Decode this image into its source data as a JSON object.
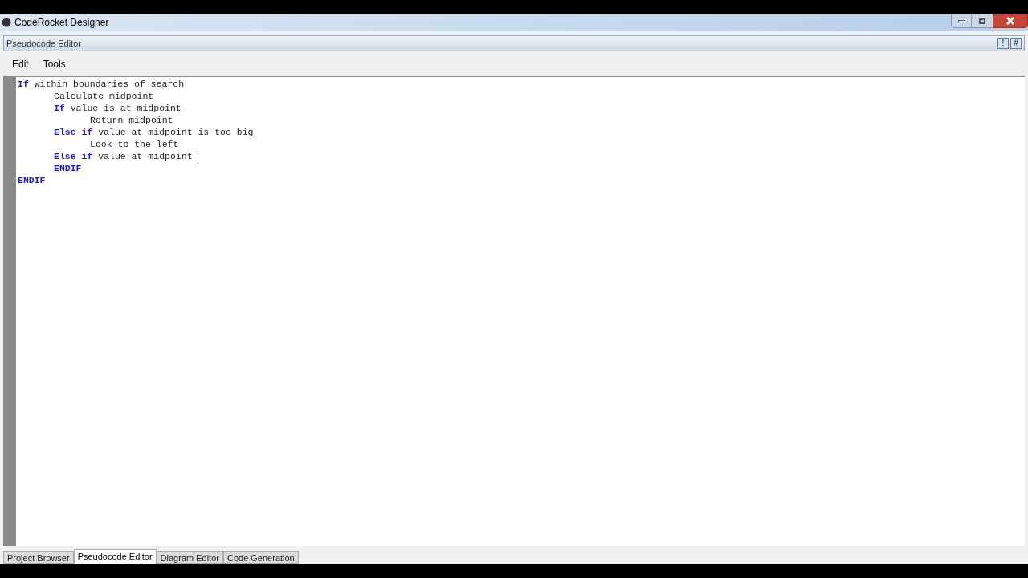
{
  "window": {
    "title": "CodeRocket Designer"
  },
  "panel": {
    "title": "Pseudocode Editor",
    "buttons": [
      "!",
      "#"
    ]
  },
  "menu": [
    "Edit",
    "Tools"
  ],
  "code": [
    {
      "tokens": [
        {
          "text": "If",
          "keyword": true
        },
        {
          "text": " within boundaries of search",
          "keyword": false
        }
      ],
      "cursor": false,
      "children": [
        {
          "tokens": [
            {
              "text": "Calculate midpoint",
              "keyword": false
            }
          ],
          "cursor": false
        },
        {
          "tokens": [
            {
              "text": "If",
              "keyword": true
            },
            {
              "text": " value is at midpoint",
              "keyword": false
            }
          ],
          "cursor": false,
          "children": [
            {
              "tokens": [
                {
                  "text": "Return midpoint",
                  "keyword": false
                }
              ],
              "cursor": false
            }
          ]
        },
        {
          "tokens": [
            {
              "text": "Else if",
              "keyword": true
            },
            {
              "text": " value at midpoint is too big",
              "keyword": false
            }
          ],
          "cursor": false,
          "children": [
            {
              "tokens": [
                {
                  "text": "Look to the left",
                  "keyword": false
                }
              ],
              "cursor": false
            }
          ]
        },
        {
          "tokens": [
            {
              "text": "Else if",
              "keyword": true
            },
            {
              "text": " value at midpoint ",
              "keyword": false
            }
          ],
          "cursor": true
        },
        {
          "tokens": [
            {
              "text": "ENDIF",
              "keyword": true
            }
          ],
          "cursor": false
        }
      ]
    },
    {
      "tokens": [
        {
          "text": "ENDIF",
          "keyword": true
        }
      ],
      "cursor": false
    }
  ],
  "tabs": [
    {
      "label": "Project Browser",
      "selected": false
    },
    {
      "label": "Pseudocode Editor",
      "selected": true
    },
    {
      "label": "Diagram Editor",
      "selected": false
    },
    {
      "label": "Code Generation",
      "selected": false
    }
  ]
}
